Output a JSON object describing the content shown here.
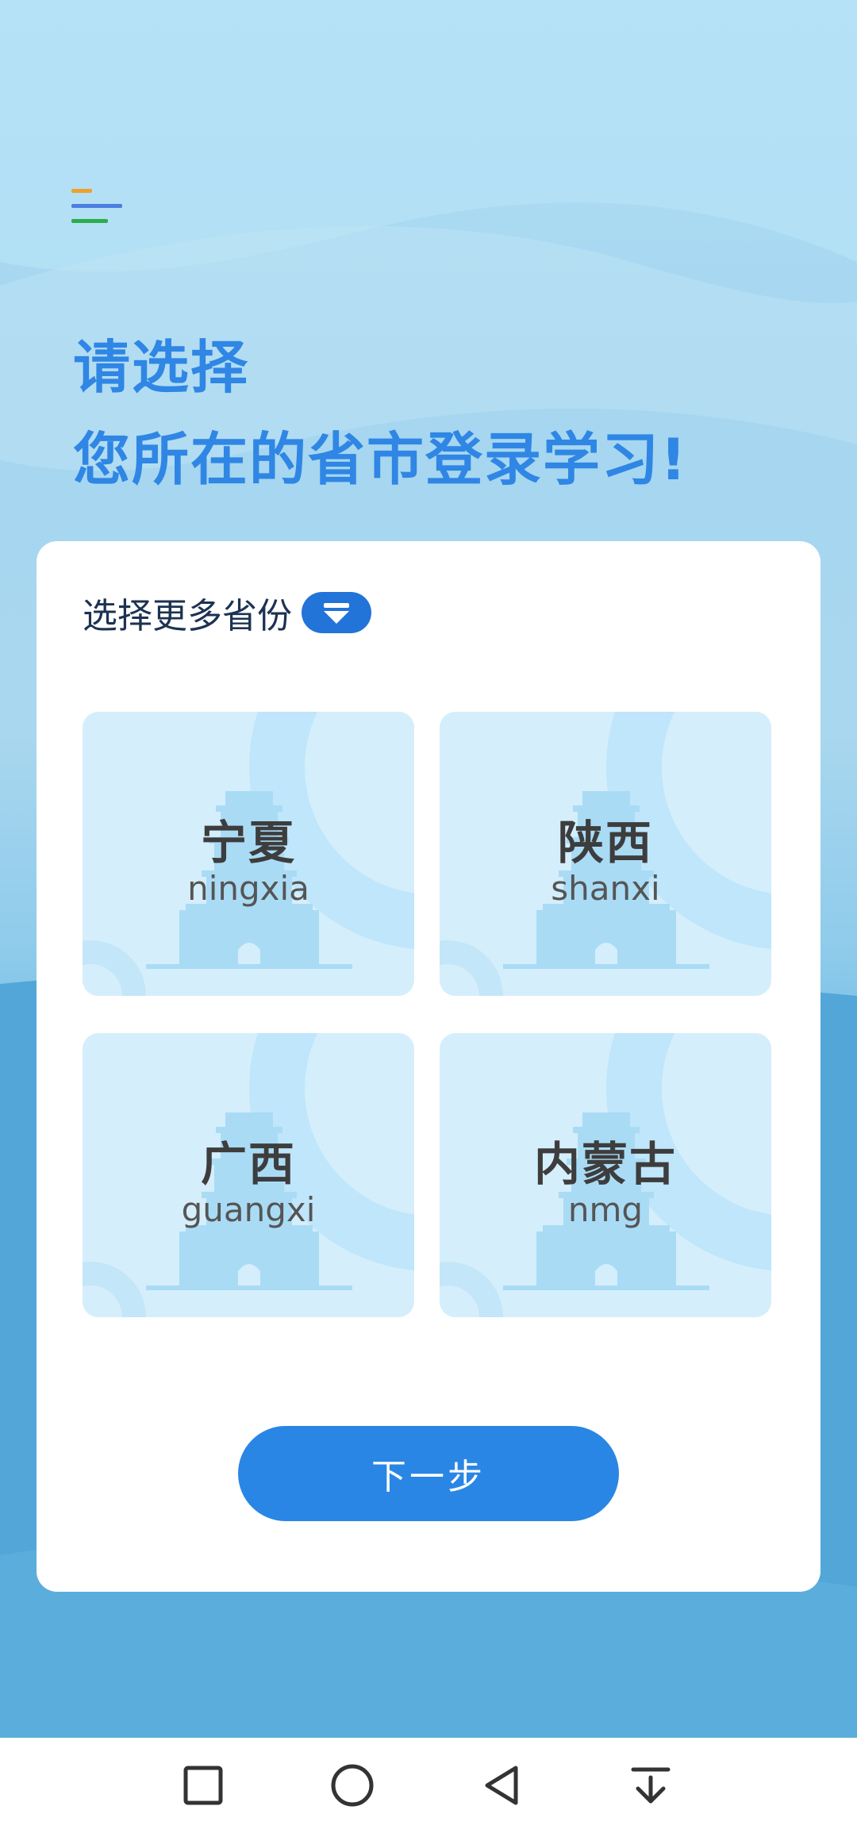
{
  "header": {
    "menu_icon": "menu-icon",
    "title_line1": "请选择",
    "title_line2": "您所在的省市登录学习!"
  },
  "selector": {
    "more_label": "选择更多省份",
    "more_icon": "chevron-down-icon"
  },
  "provinces": [
    {
      "name": "宁夏",
      "pinyin": "ningxia"
    },
    {
      "name": "陕西",
      "pinyin": "shanxi"
    },
    {
      "name": "广西",
      "pinyin": "guangxi"
    },
    {
      "name": "内蒙古",
      "pinyin": "nmg"
    }
  ],
  "actions": {
    "next_label": "下一步"
  },
  "navigation_bar": {
    "recents_icon": "square-icon",
    "home_icon": "circle-icon",
    "back_icon": "triangle-back-icon",
    "notifications_icon": "pull-down-icon"
  },
  "colors": {
    "accent": "#2a86e4",
    "headline": "#2f86e4",
    "tile_bg": "#d5eefb"
  }
}
